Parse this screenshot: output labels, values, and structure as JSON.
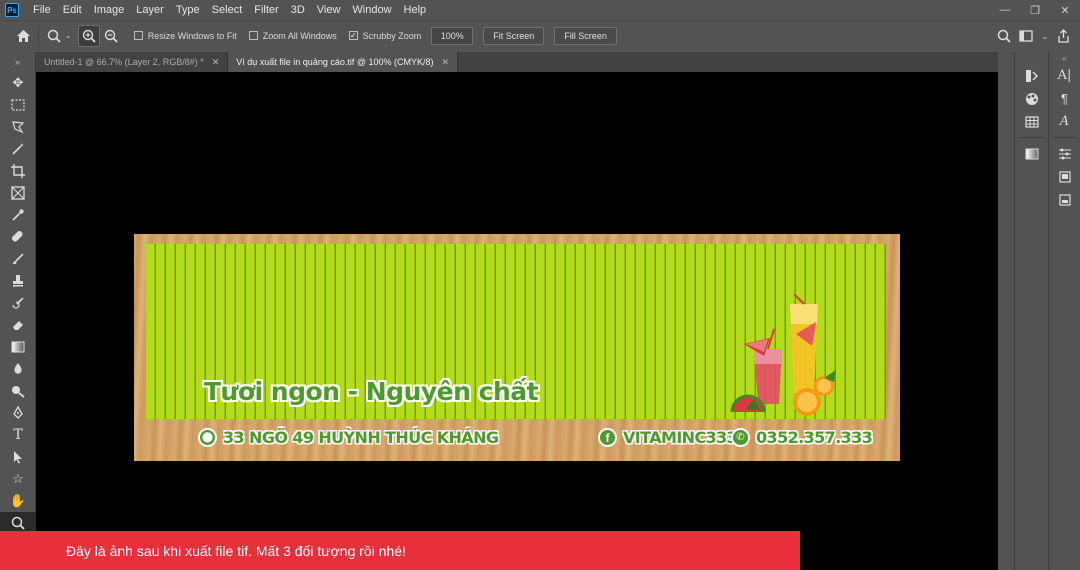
{
  "app": {
    "logo": "Ps"
  },
  "menu": [
    "File",
    "Edit",
    "Image",
    "Layer",
    "Type",
    "Select",
    "Filter",
    "3D",
    "View",
    "Window",
    "Help"
  ],
  "window_controls": {
    "minimize": "—",
    "restore": "❐",
    "close": "✕"
  },
  "options": {
    "home_icon": "home-icon",
    "resize_windows_label": "Resize Windows to Fit",
    "resize_windows_checked": false,
    "zoom_all_label": "Zoom All Windows",
    "zoom_all_checked": false,
    "scrubby_zoom_label": "Scrubby Zoom",
    "scrubby_zoom_checked": true,
    "zoom_value": "100%",
    "fit_screen_label": "Fit Screen",
    "fill_screen_label": "Fill Screen"
  },
  "tabs": [
    {
      "label": "Untitled-1 @ 66.7% (Layer 2, RGB/8#) *",
      "active": false
    },
    {
      "label": "Ví dụ xuất file in quảng cáo.tif @ 100% (CMYK/8)",
      "active": true
    }
  ],
  "banner": {
    "slogan": "Tươi ngon - Nguyên chất",
    "address": "33 NGÕ 49 HUỲNH THÚC KHÁNG",
    "facebook": "VITAMINC333",
    "phone": "0352.357.333",
    "colors": {
      "green": "#b4dc1a",
      "stripe": "#6d9f1f",
      "text": "#4e9a2c"
    }
  },
  "notice": "Đây là ảnh sau khi xuất file tif. Mất 3 đối tượng rồi nhé!"
}
